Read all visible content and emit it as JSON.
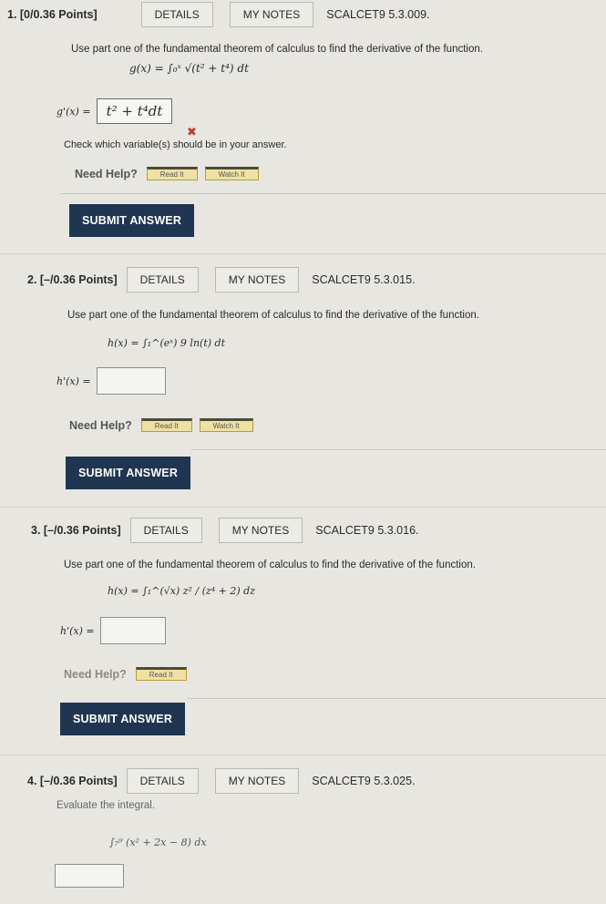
{
  "questions": [
    {
      "number": "1. [0/0.36 Points]",
      "details": "DETAILS",
      "notes": "MY NOTES",
      "code": "SCALCET9 5.3.009.",
      "prompt": "Use part one of the fundamental theorem of calculus to find the derivative of the function.",
      "function": "g(x) = ∫₀ˣ √(t² + t⁴) dt",
      "answer_label": "g'(x) =",
      "answer_value": "t² + t⁴dt",
      "error_icon": "✖",
      "feedback": "Check which variable(s) should be in your answer.",
      "help_label": "Need Help?",
      "help_buttons": [
        "Read It",
        "Watch It"
      ],
      "submit": "SUBMIT ANSWER"
    },
    {
      "number": "2. [–/0.36 Points]",
      "details": "DETAILS",
      "notes": "MY NOTES",
      "code": "SCALCET9 5.3.015.",
      "prompt": "Use part one of the fundamental theorem of calculus to find the derivative of the function.",
      "function": "h(x) = ∫₁^(eˣ) 9 ln(t) dt",
      "answer_label": "h'(x) =",
      "help_label": "Need Help?",
      "help_buttons": [
        "Read It",
        "Watch It"
      ],
      "submit": "SUBMIT ANSWER"
    },
    {
      "number": "3. [–/0.36 Points]",
      "details": "DETAILS",
      "notes": "MY NOTES",
      "code": "SCALCET9 5.3.016.",
      "prompt": "Use part one of the fundamental theorem of calculus to find the derivative of the function.",
      "function": "h(x) = ∫₁^(√x) z² / (z⁴ + 2) dz",
      "answer_label": "h'(x) =",
      "help_label": "Need Help?",
      "help_buttons": [
        "Read It"
      ],
      "submit": "SUBMIT ANSWER"
    },
    {
      "number": "4. [–/0.36 Points]",
      "details": "DETAILS",
      "notes": "MY NOTES",
      "code": "SCALCET9 5.3.025.",
      "prompt": "Evaluate the integral.",
      "function": "∫₇⁹ (x² + 2x − 8) dx"
    }
  ]
}
